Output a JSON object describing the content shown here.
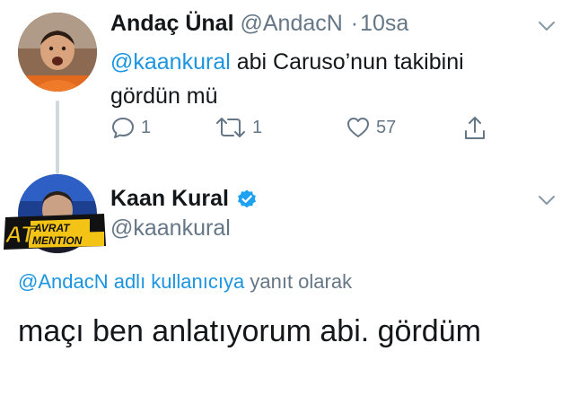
{
  "reply_tweet": {
    "display_name": "Andaç Ünal",
    "handle": "@AndacN",
    "separator": "·",
    "time": "10sa",
    "mention": "@kaankural",
    "text_line1_rest": " abi Caruso’nun takibini",
    "text_line2": "gördün mü",
    "actions": {
      "reply_count": "1",
      "retweet_count": "1",
      "like_count": "57"
    }
  },
  "main_tweet": {
    "display_name": "Kaan Kural",
    "handle": "@kaankural",
    "verified": true,
    "reply_context_link": "@AndacN adlı kullanıcıya",
    "reply_context_rest": " yanıt olarak",
    "text": "maçı ben anlatıyorum abi. gördüm",
    "avatar_logo": {
      "line1": "AVRAT",
      "line2": "MENTION",
      "prefix": "AT"
    }
  },
  "colors": {
    "link": "#1b95e0",
    "secondary": "#657786",
    "verified": "#1da1f2",
    "thread_line": "#cfd9de"
  },
  "icons": [
    "reply-icon",
    "retweet-icon",
    "like-icon",
    "share-icon",
    "chevron-down-icon",
    "verified-badge-icon"
  ]
}
